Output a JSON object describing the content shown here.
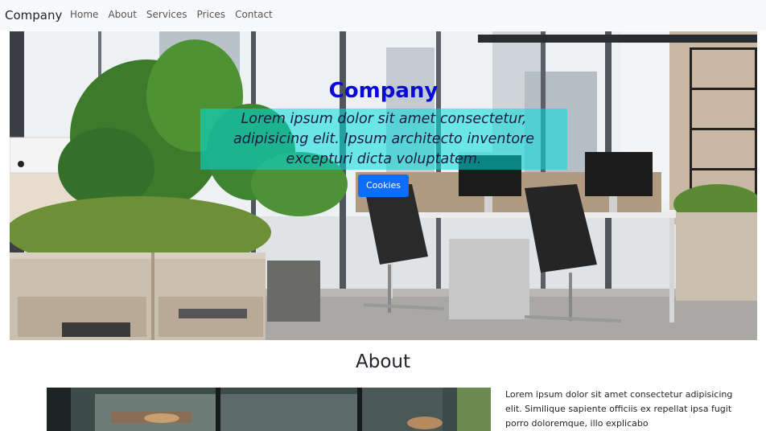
{
  "navbar": {
    "brand": "Company",
    "links": [
      "Home",
      "About",
      "Services",
      "Prices",
      "Contact"
    ]
  },
  "hero": {
    "title": "Company",
    "text": "Lorem ipsum dolor sit amet consectetur, adipisicing elit. Ipsum architecto inventore excepturi dicta voluptatem.",
    "button_label": "Cookies"
  },
  "about": {
    "title": "About",
    "text": "Lorem ipsum dolor sit amet consectetur adipisicing elit. Similique sapiente officiis ex repellat ipsa fugit porro doloremque, illo explicabo"
  },
  "colors": {
    "navbar_bg": "#f8f9fa",
    "hero_title": "#0a0ad8",
    "text_box": "#00dcdc",
    "button": "#0d6efd"
  }
}
